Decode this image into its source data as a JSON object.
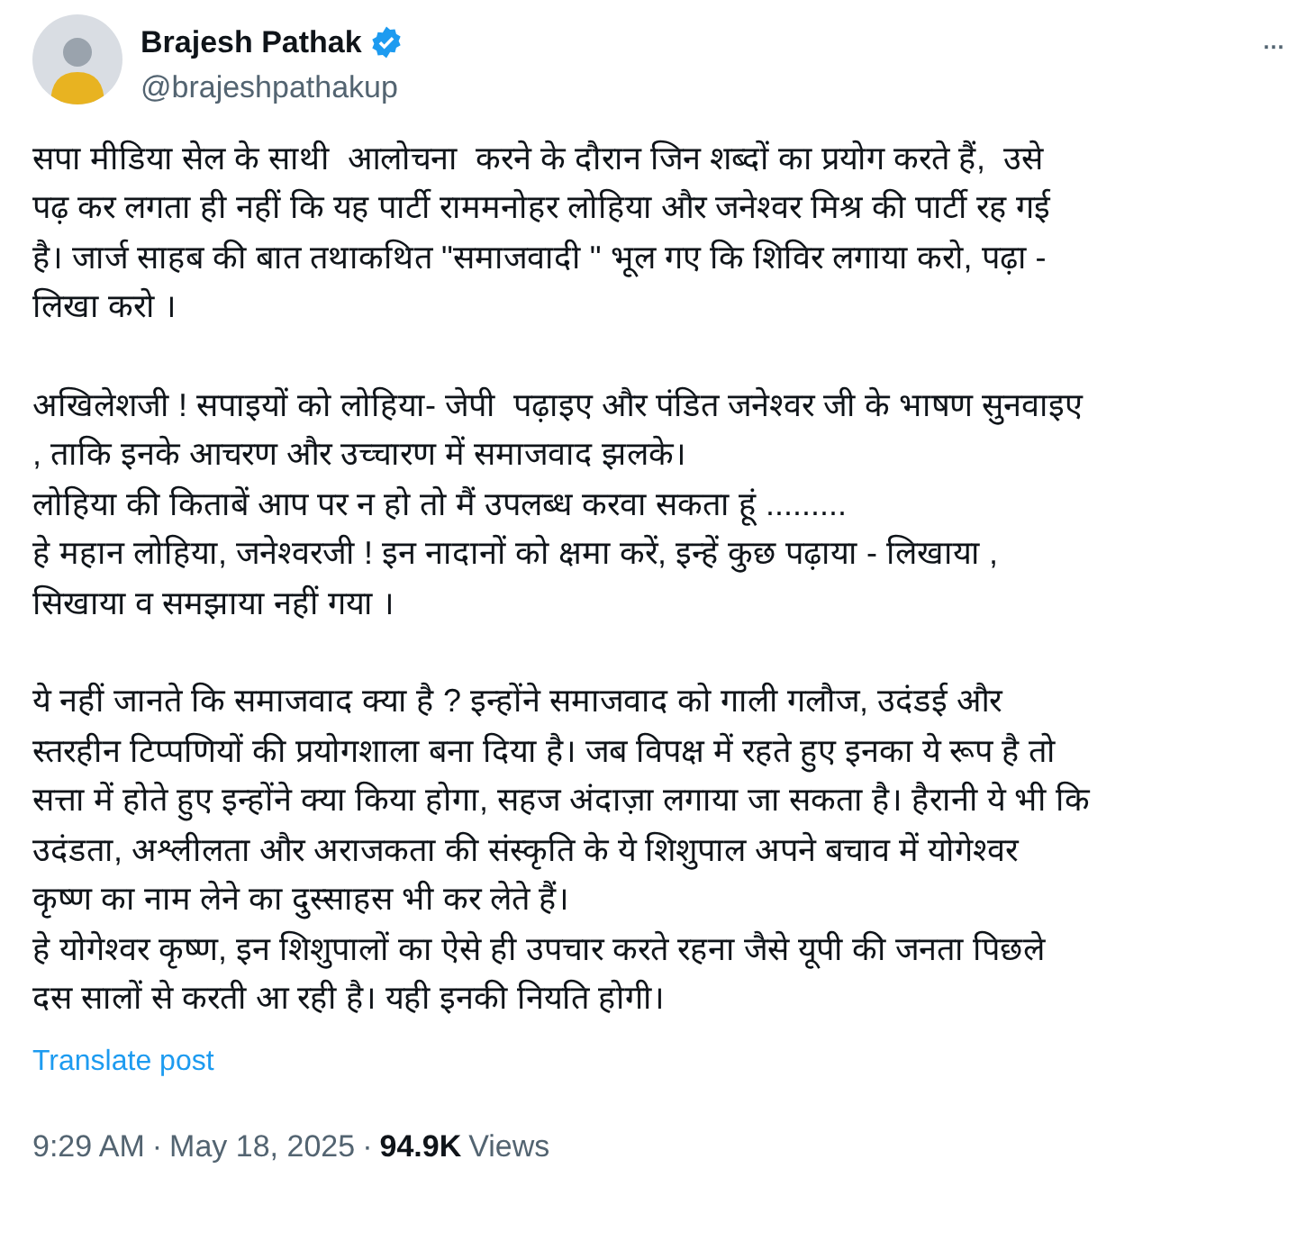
{
  "author": {
    "name": "Brajesh Pathak",
    "verified": true,
    "handle": "@brajeshpathakup"
  },
  "more_button": "···",
  "paragraphs": [
    [
      "सपा मीडिया सेल के साथी  आलोचना  करने के दौरान जिन शब्दों का प्रयोग करते हैं,  उसे",
      "पढ़ कर लगता ही नहीं कि यह पार्टी राममनोहर लोहिया और जनेश्वर मिश्र की पार्टी रह गई",
      "है। जार्ज साहब की बात तथाकथित \"समाजवादी \" भूल गए कि शिविर लगाया करो, पढ़ा -",
      "लिखा करो ।"
    ],
    [
      "अखिलेशजी ! सपाइयों को लोहिया- जेपी  पढ़ाइए और पंडित जनेश्वर जी के भाषण सुनवाइए",
      ", ताकि इनके आचरण और उच्चारण में समाजवाद झलके।",
      "लोहिया की किताबें आप पर न हो तो मैं उपलब्ध करवा सकता हूं .........",
      "हे महान लोहिया, जनेश्वरजी ! इन नादानों को क्षमा करें, इन्हें कुछ पढ़ाया - लिखाया ,",
      "सिखाया व समझाया नहीं गया ।"
    ],
    [
      "ये नहीं जानते कि समाजवाद क्या है ? इन्होंने समाजवाद को गाली गलौज, उदंडई और",
      "स्तरहीन टिप्पणियों की प्रयोगशाला बना दिया है। जब विपक्ष में रहते हुए इनका ये रूप है तो",
      "सत्ता में होते हुए इन्होंने क्या किया होगा, सहज अंदाज़ा लगाया जा सकता है। हैरानी ये भी कि",
      "उदंडता, अश्लीलता और अराजकता की संस्कृति के ये शिशुपाल अपने बचाव में योगेश्वर",
      "कृष्ण का नाम लेने का दुस्साहस भी कर लेते हैं।",
      "हे योगेश्वर कृष्ण, इन शिशुपालों का ऐसे ही उपचार करते रहना जैसे यूपी की जनता पिछले",
      "दस सालों से करती आ रही है। यही इनकी नियति होगी।"
    ]
  ],
  "translate_link": "Translate post",
  "footer": {
    "time": "9:29 AM",
    "separator_1": "·",
    "date": "May 18, 2025",
    "separator_2": "·",
    "views_count": "94.9K",
    "views_label": "Views"
  }
}
